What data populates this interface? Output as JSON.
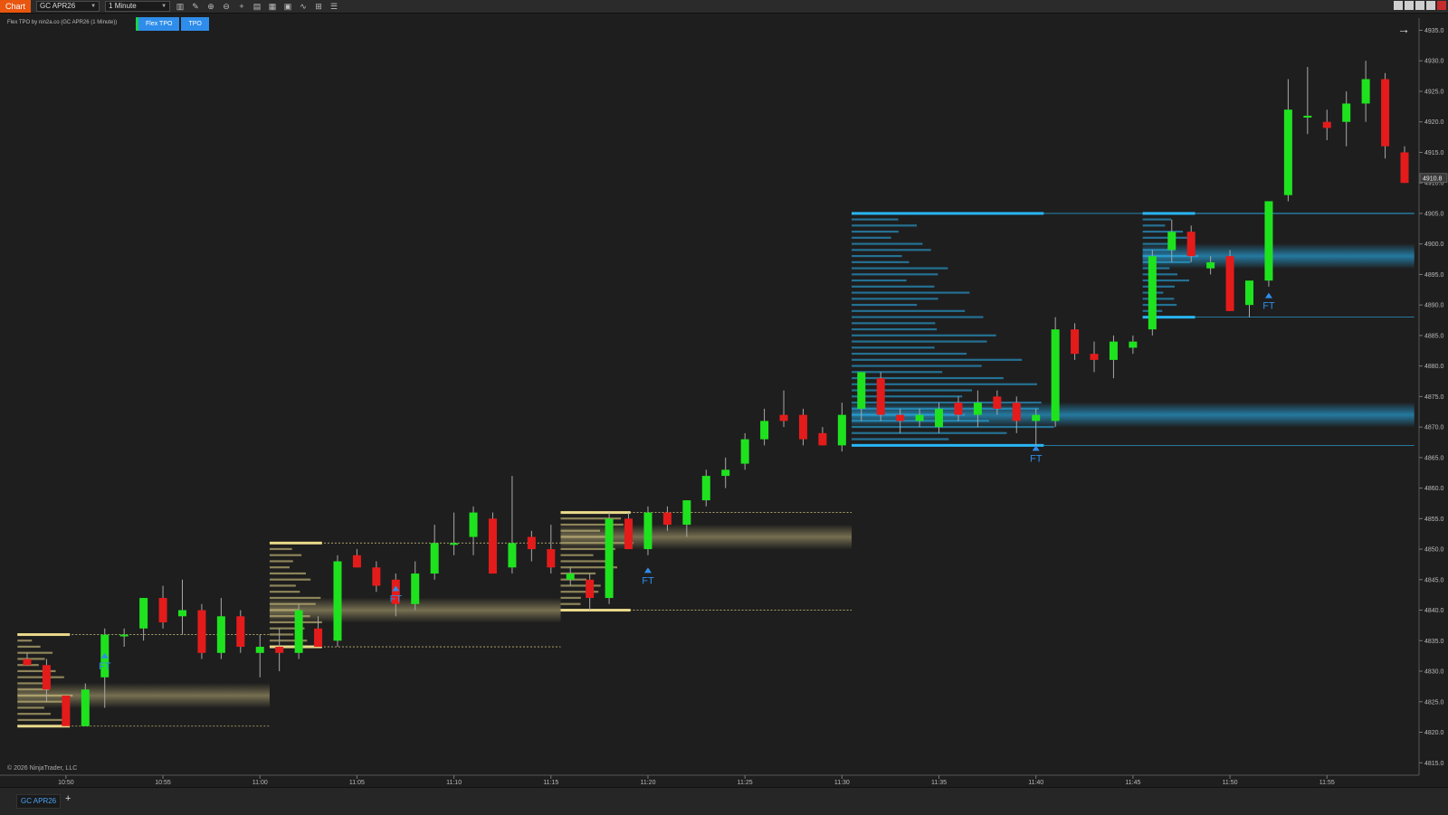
{
  "toolbar": {
    "chart_tab": "Chart",
    "instrument": "GC APR26",
    "timeframe": "1 Minute"
  },
  "indicator": {
    "label": "Flex TPO by nin2a.co (GC APR26 (1 Minute))",
    "buttons": [
      "Flex TPO",
      "TPO"
    ]
  },
  "footer": {
    "copyright": "© 2026 NinjaTrader, LLC",
    "instrument_tab": "GC APR26",
    "add_tab": "+"
  },
  "colors": {
    "background": "#1e1e1e",
    "bull": "#1fe21f",
    "bear": "#e41b1b",
    "tpo_gold": "#e9d98a",
    "tpo_blue": "#29b6f6",
    "marker": "#2e8dea"
  },
  "chart_data": {
    "type": "candlestick",
    "y_axis": {
      "ticks": [
        "4815.0",
        "4820.0",
        "4825.0",
        "4830.0",
        "4835.0",
        "4840.0",
        "4845.0",
        "4850.0",
        "4855.0",
        "4860.0",
        "4865.0",
        "4870.0",
        "4875.0",
        "4880.0",
        "4885.0",
        "4890.0",
        "4895.0",
        "4900.0",
        "4905.0",
        "4910.0",
        "4915.0",
        "4920.0",
        "4925.0",
        "4930.0",
        "4935.0"
      ],
      "range": [
        4814,
        4937
      ],
      "last_price": "4910.8"
    },
    "x_axis": {
      "ticks": [
        "10:50",
        "10:55",
        "11:00",
        "11:05",
        "11:10",
        "11:15",
        "11:20",
        "11:25",
        "11:30",
        "11:35",
        "11:40",
        "11:45",
        "11:50",
        "11:55"
      ],
      "start": "10:48",
      "end": "11:56"
    },
    "candles": [
      {
        "t": "10:48",
        "o": 4832,
        "h": 4833,
        "l": 4831,
        "c": 4831
      },
      {
        "t": "10:49",
        "o": 4831,
        "h": 4832,
        "l": 4825,
        "c": 4827
      },
      {
        "t": "10:50",
        "o": 4826,
        "h": 4826,
        "l": 4821,
        "c": 4821
      },
      {
        "t": "10:51",
        "o": 4821,
        "h": 4828,
        "l": 4821,
        "c": 4827
      },
      {
        "t": "10:52",
        "o": 4829,
        "h": 4837,
        "l": 4824,
        "c": 4836
      },
      {
        "t": "10:53",
        "o": 4836,
        "h": 4837,
        "l": 4834,
        "c": 4836
      },
      {
        "t": "10:54",
        "o": 4837,
        "h": 4842,
        "l": 4835,
        "c": 4842
      },
      {
        "t": "10:55",
        "o": 4842,
        "h": 4844,
        "l": 4837,
        "c": 4838
      },
      {
        "t": "10:56",
        "o": 4839,
        "h": 4845,
        "l": 4836,
        "c": 4840
      },
      {
        "t": "10:57",
        "o": 4840,
        "h": 4841,
        "l": 4832,
        "c": 4833
      },
      {
        "t": "10:58",
        "o": 4833,
        "h": 4842,
        "l": 4832,
        "c": 4839
      },
      {
        "t": "10:59",
        "o": 4839,
        "h": 4840,
        "l": 4833,
        "c": 4834
      },
      {
        "t": "11:00",
        "o": 4833,
        "h": 4836,
        "l": 4829,
        "c": 4834
      },
      {
        "t": "11:01",
        "o": 4834,
        "h": 4837,
        "l": 4830,
        "c": 4833
      },
      {
        "t": "11:02",
        "o": 4833,
        "h": 4841,
        "l": 4832,
        "c": 4840
      },
      {
        "t": "11:03",
        "o": 4837,
        "h": 4839,
        "l": 4834,
        "c": 4834
      },
      {
        "t": "11:04",
        "o": 4835,
        "h": 4849,
        "l": 4834,
        "c": 4848
      },
      {
        "t": "11:05",
        "o": 4849,
        "h": 4850,
        "l": 4847,
        "c": 4847
      },
      {
        "t": "11:06",
        "o": 4847,
        "h": 4848,
        "l": 4843,
        "c": 4844
      },
      {
        "t": "11:07",
        "o": 4845,
        "h": 4846,
        "l": 4839,
        "c": 4841
      },
      {
        "t": "11:08",
        "o": 4841,
        "h": 4848,
        "l": 4840,
        "c": 4846
      },
      {
        "t": "11:09",
        "o": 4846,
        "h": 4854,
        "l": 4845,
        "c": 4851
      },
      {
        "t": "11:10",
        "o": 4851,
        "h": 4856,
        "l": 4849,
        "c": 4851
      },
      {
        "t": "11:11",
        "o": 4852,
        "h": 4857,
        "l": 4849,
        "c": 4856
      },
      {
        "t": "11:12",
        "o": 4855,
        "h": 4856,
        "l": 4846,
        "c": 4846
      },
      {
        "t": "11:13",
        "o": 4847,
        "h": 4862,
        "l": 4846,
        "c": 4851
      },
      {
        "t": "11:14",
        "o": 4852,
        "h": 4853,
        "l": 4848,
        "c": 4850
      },
      {
        "t": "11:15",
        "o": 4850,
        "h": 4854,
        "l": 4846,
        "c": 4847
      },
      {
        "t": "11:16",
        "o": 4845,
        "h": 4847,
        "l": 4844,
        "c": 4846
      },
      {
        "t": "11:17",
        "o": 4845,
        "h": 4846,
        "l": 4840,
        "c": 4842
      },
      {
        "t": "11:18",
        "o": 4842,
        "h": 4856,
        "l": 4841,
        "c": 4855
      },
      {
        "t": "11:19",
        "o": 4855,
        "h": 4856,
        "l": 4850,
        "c": 4850
      },
      {
        "t": "11:20",
        "o": 4850,
        "h": 4857,
        "l": 4849,
        "c": 4856
      },
      {
        "t": "11:21",
        "o": 4856,
        "h": 4857,
        "l": 4853,
        "c": 4854
      },
      {
        "t": "11:22",
        "o": 4854,
        "h": 4858,
        "l": 4852,
        "c": 4858
      },
      {
        "t": "11:23",
        "o": 4858,
        "h": 4863,
        "l": 4857,
        "c": 4862
      },
      {
        "t": "11:24",
        "o": 4862,
        "h": 4865,
        "l": 4860,
        "c": 4863
      },
      {
        "t": "11:25",
        "o": 4864,
        "h": 4869,
        "l": 4863,
        "c": 4868
      },
      {
        "t": "11:26",
        "o": 4868,
        "h": 4873,
        "l": 4867,
        "c": 4871
      },
      {
        "t": "11:27",
        "o": 4872,
        "h": 4876,
        "l": 4870,
        "c": 4871
      },
      {
        "t": "11:28",
        "o": 4872,
        "h": 4873,
        "l": 4867,
        "c": 4868
      },
      {
        "t": "11:29",
        "o": 4869,
        "h": 4870,
        "l": 4867,
        "c": 4867
      },
      {
        "t": "11:30",
        "o": 4867,
        "h": 4874,
        "l": 4866,
        "c": 4872
      },
      {
        "t": "11:31",
        "o": 4873,
        "h": 4879,
        "l": 4871,
        "c": 4879
      },
      {
        "t": "11:32",
        "o": 4878,
        "h": 4879,
        "l": 4871,
        "c": 4872
      },
      {
        "t": "11:33",
        "o": 4872,
        "h": 4873,
        "l": 4869,
        "c": 4871
      },
      {
        "t": "11:34",
        "o": 4871,
        "h": 4873,
        "l": 4870,
        "c": 4872
      },
      {
        "t": "11:35",
        "o": 4870,
        "h": 4874,
        "l": 4869,
        "c": 4873
      },
      {
        "t": "11:36",
        "o": 4874,
        "h": 4875,
        "l": 4871,
        "c": 4872
      },
      {
        "t": "11:37",
        "o": 4872,
        "h": 4876,
        "l": 4870,
        "c": 4874
      },
      {
        "t": "11:38",
        "o": 4875,
        "h": 4876,
        "l": 4872,
        "c": 4873
      },
      {
        "t": "11:39",
        "o": 4874,
        "h": 4875,
        "l": 4869,
        "c": 4871
      },
      {
        "t": "11:40",
        "o": 4871,
        "h": 4873,
        "l": 4867,
        "c": 4872
      },
      {
        "t": "11:41",
        "o": 4871,
        "h": 4888,
        "l": 4870,
        "c": 4886
      },
      {
        "t": "11:42",
        "o": 4886,
        "h": 4887,
        "l": 4881,
        "c": 4882
      },
      {
        "t": "11:43",
        "o": 4882,
        "h": 4884,
        "l": 4879,
        "c": 4881
      },
      {
        "t": "11:44",
        "o": 4881,
        "h": 4885,
        "l": 4878,
        "c": 4884
      },
      {
        "t": "11:45",
        "o": 4883,
        "h": 4885,
        "l": 4882,
        "c": 4884
      },
      {
        "t": "11:46",
        "o": 4886,
        "h": 4899,
        "l": 4885,
        "c": 4898
      },
      {
        "t": "11:47",
        "o": 4899,
        "h": 4904,
        "l": 4897,
        "c": 4902
      },
      {
        "t": "11:48",
        "o": 4902,
        "h": 4903,
        "l": 4897,
        "c": 4898
      },
      {
        "t": "11:49",
        "o": 4896,
        "h": 4898,
        "l": 4895,
        "c": 4897
      },
      {
        "t": "11:50",
        "o": 4898,
        "h": 4899,
        "l": 4889,
        "c": 4889
      },
      {
        "t": "11:51",
        "o": 4890,
        "h": 4892,
        "l": 4888,
        "c": 4894
      },
      {
        "t": "11:52",
        "o": 4894,
        "h": 4906,
        "l": 4893,
        "c": 4907
      },
      {
        "t": "11:53",
        "o": 4908,
        "h": 4927,
        "l": 4907,
        "c": 4922
      },
      {
        "t": "11:54",
        "o": 4921,
        "h": 4929,
        "l": 4918,
        "c": 4921
      },
      {
        "t": "11:55",
        "o": 4920,
        "h": 4922,
        "l": 4917,
        "c": 4919
      },
      {
        "t": "11:56",
        "o": 4920,
        "h": 4925,
        "l": 4916,
        "c": 4923
      },
      {
        "t": "11:57",
        "o": 4923,
        "h": 4930,
        "l": 4920,
        "c": 4927
      },
      {
        "t": "11:58",
        "o": 4927,
        "h": 4928,
        "l": 4914,
        "c": 4916
      },
      {
        "t": "11:59",
        "o": 4915,
        "h": 4916,
        "l": 4910,
        "c": 4910
      }
    ],
    "tpo_profiles": [
      {
        "color": "gold",
        "start": "10:48",
        "end": "10:50",
        "high": 4836,
        "low": 4821,
        "poc": 4826,
        "extend_to": "11:00"
      },
      {
        "color": "gold",
        "start": "11:01",
        "end": "11:03",
        "high": 4851,
        "low": 4834,
        "poc": 4840,
        "extend_to": "11:15"
      },
      {
        "color": "gold",
        "start": "11:16",
        "end": "11:19",
        "high": 4856,
        "low": 4840,
        "poc": 4852,
        "extend_to": "11:30"
      },
      {
        "color": "blue",
        "start": "11:31",
        "end": "11:41",
        "high": 4905,
        "low": 4867,
        "poc": 4872,
        "extend_to": "11:59"
      },
      {
        "color": "blue",
        "start": "11:46",
        "end": "11:48",
        "high": 4905,
        "low": 4888,
        "poc": 4898,
        "extend_to": "11:59"
      }
    ],
    "markers": [
      {
        "t": "10:52",
        "price": 4833,
        "label": "FT"
      },
      {
        "t": "11:07",
        "price": 4844,
        "label": "FT"
      },
      {
        "t": "11:20",
        "price": 4847,
        "label": "FT"
      },
      {
        "t": "11:40",
        "price": 4867,
        "label": "FT"
      },
      {
        "t": "11:52",
        "price": 4892,
        "label": "FT"
      }
    ]
  }
}
